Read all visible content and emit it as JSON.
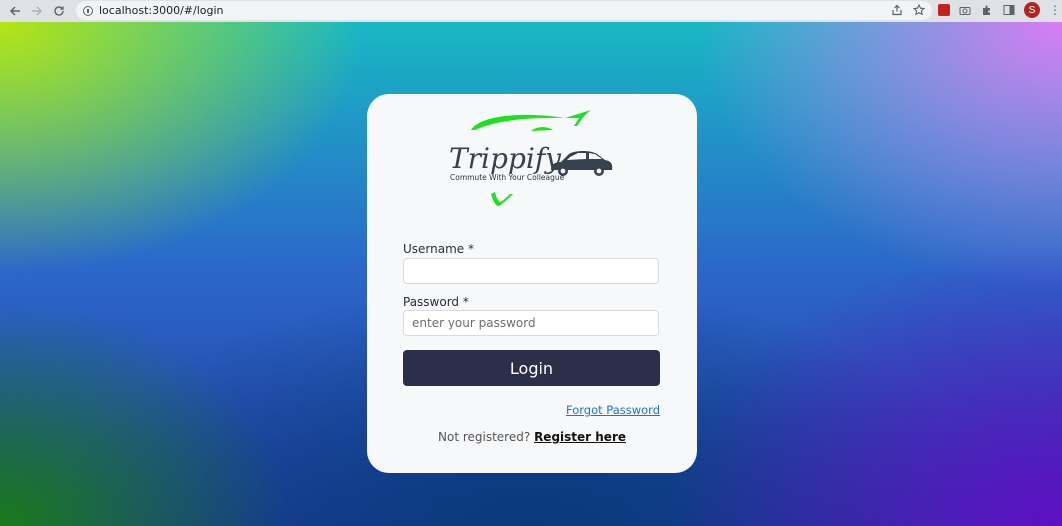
{
  "browser": {
    "url": "localhost:3000/#/login",
    "avatar_letter": "S",
    "menu_icon": "⋮"
  },
  "logo": {
    "brand": "Trippify",
    "tagline": "Commute With Your Colleague",
    "accent_color": "#1ee01e",
    "car_color": "#37414f"
  },
  "form": {
    "username_label": "Username *",
    "username_value": "",
    "password_label": "Password *",
    "password_placeholder": "enter your password",
    "login_label": "Login",
    "forgot_label": "Forgot Password",
    "register_prompt": "Not registered?",
    "register_label": "Register here"
  },
  "colors": {
    "button_bg": "#2c2f4a",
    "link": "#1a73e8",
    "card_bg": "#f7f8fa"
  }
}
